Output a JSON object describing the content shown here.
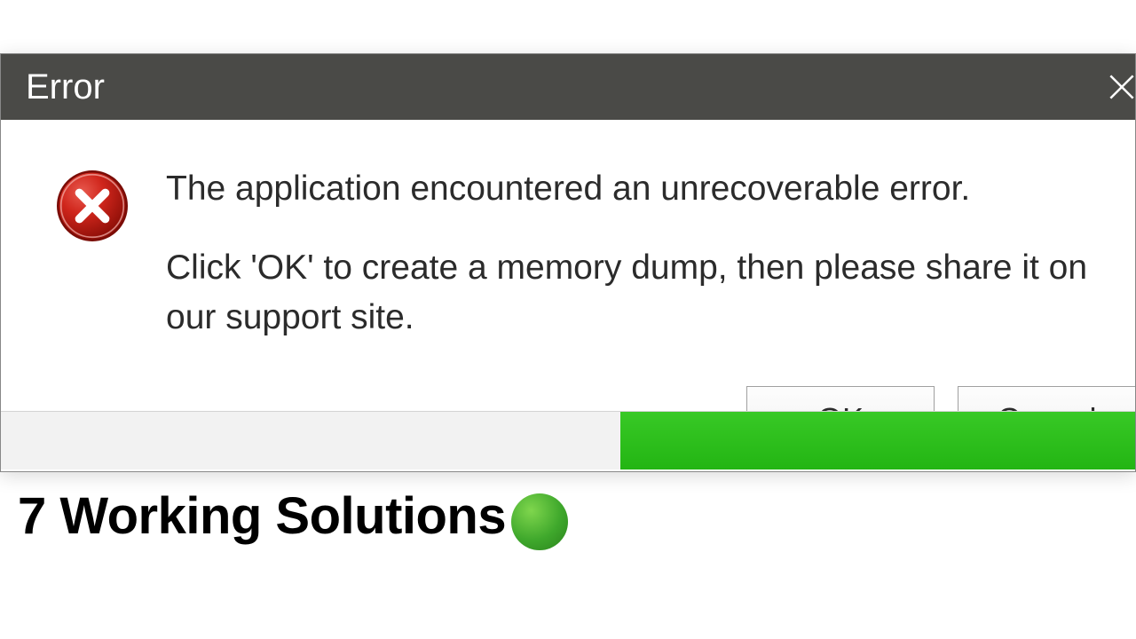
{
  "dialog": {
    "title": "Error",
    "message_line1": "The application encountered an unrecoverable error.",
    "message_line2": "Click 'OK' to create a memory dump, then please share it on our support site.",
    "ok_label": "OK",
    "cancel_label": "Cancel"
  },
  "overlay": {
    "caption": "7 Working Solutions"
  }
}
